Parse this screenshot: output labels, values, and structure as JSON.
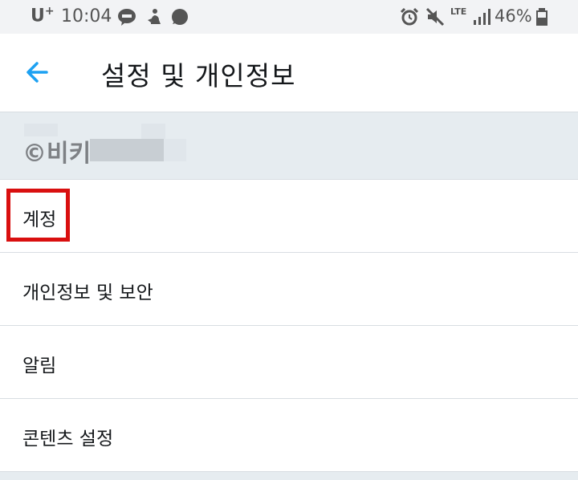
{
  "status_bar": {
    "carrier": "U",
    "carrier_sup": "+",
    "time": "10:04",
    "battery": "46%",
    "network": "LTE",
    "icons": [
      "talk-icon",
      "person-icon",
      "chat-bubble-icon",
      "alarm-icon",
      "mute-icon",
      "signal-icon",
      "battery-icon"
    ]
  },
  "header": {
    "back_icon": "arrow-left-icon",
    "title": "설정 및 개인정보"
  },
  "account": {
    "watermark": "©비키"
  },
  "menu": {
    "items": [
      {
        "label": "계정"
      },
      {
        "label": "개인정보 및 보안"
      },
      {
        "label": "알림"
      },
      {
        "label": "콘텐츠 설정"
      }
    ]
  },
  "colors": {
    "accent": "#1da1f2",
    "band": "#e6ecf0",
    "divider": "#d8dde2",
    "highlight": "#d90f0f"
  }
}
